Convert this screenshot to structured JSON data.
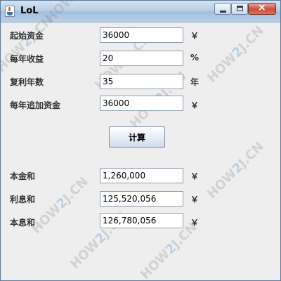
{
  "window": {
    "title": "LoL"
  },
  "inputs": [
    {
      "label": "起始资金",
      "value": "36000",
      "unit": "￥"
    },
    {
      "label": "每年收益",
      "value": "20",
      "unit": "%"
    },
    {
      "label": "复利年数",
      "value": "35",
      "unit": "年"
    },
    {
      "label": "每年追加资金",
      "value": "36000",
      "unit": "￥"
    }
  ],
  "calculate_button": {
    "label": "计算"
  },
  "results": [
    {
      "label": "本金和",
      "value": "1,260,000",
      "unit": "￥"
    },
    {
      "label": "利息和",
      "value": "125,520,056",
      "unit": "￥"
    },
    {
      "label": "本息和",
      "value": "126,780,056",
      "unit": "￥"
    }
  ],
  "watermark": {
    "part1": "HOW",
    "part2": "2",
    "part3": "J.CN"
  },
  "colors": {
    "window_bg": "#eeeeee",
    "titlebar": "#b8cfe6",
    "close_button": "#c8503c"
  }
}
